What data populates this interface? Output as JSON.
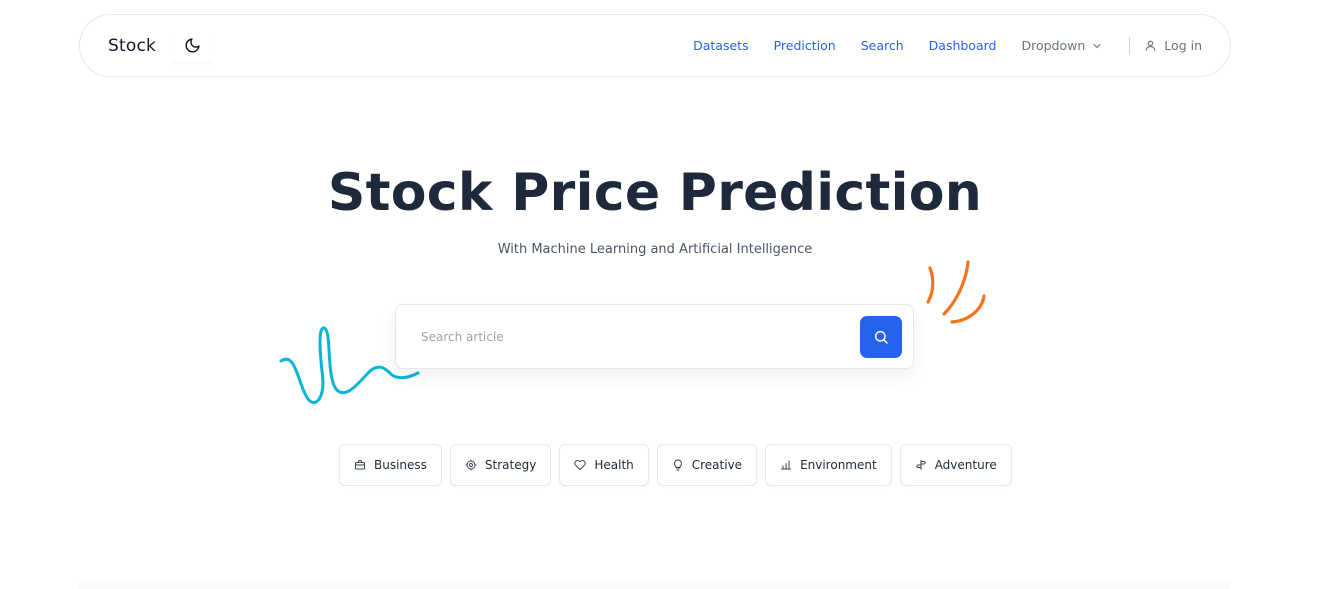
{
  "nav": {
    "brand": "Stock",
    "links": [
      "Datasets",
      "Prediction",
      "Search",
      "Dashboard"
    ],
    "dropdown": "Dropdown",
    "login": "Log in",
    "icons": {
      "theme": "moon-icon",
      "dropdown": "chevron-down-icon",
      "login": "user-icon"
    }
  },
  "hero": {
    "title": "Stock Price Prediction",
    "subtitle": "With Machine Learning and Artificial Intelligence"
  },
  "search": {
    "placeholder": "Search article",
    "value": ""
  },
  "categories": [
    {
      "label": "Business",
      "icon": "briefcase-icon"
    },
    {
      "label": "Strategy",
      "icon": "settings-icon"
    },
    {
      "label": "Health",
      "icon": "heart-icon"
    },
    {
      "label": "Creative",
      "icon": "lightbulb-icon"
    },
    {
      "label": "Environment",
      "icon": "chart-icon"
    },
    {
      "label": "Adventure",
      "icon": "signpost-icon"
    }
  ],
  "colors": {
    "accent": "#2563eb",
    "title": "#1e293b",
    "doodle_blue": "#06b6d4",
    "doodle_orange": "#f97316"
  }
}
